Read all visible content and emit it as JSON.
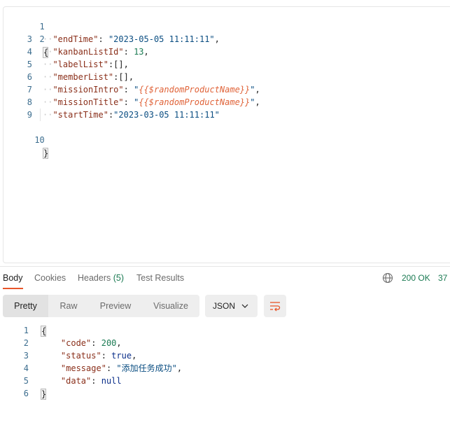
{
  "request_editor": {
    "line_numbers": [
      "1",
      "2",
      "3",
      "4",
      "5",
      "6",
      "7",
      "8",
      "9",
      "10"
    ],
    "open_brace": "{",
    "close_brace": "}",
    "lines": [
      {
        "key": "\"endTime\"",
        "sep": ": ",
        "value": "\"2023-05-05 11:11:11\"",
        "value_kind": "str",
        "trail": ","
      },
      {
        "key": "\"kanbanListId\"",
        "sep": ": ",
        "value": "13",
        "value_kind": "num",
        "trail": ","
      },
      {
        "key": "\"labelList\"",
        "sep": ":",
        "value": "[]",
        "value_kind": "plain",
        "trail": ","
      },
      {
        "key": "\"memberList\"",
        "sep": ":",
        "value": "[]",
        "value_kind": "plain",
        "trail": ","
      },
      {
        "key": "\"missionIntro\"",
        "sep": ": ",
        "value_prefix": "\"",
        "value": "{{$randomProductName}}",
        "value_suffix": "\"",
        "value_kind": "var",
        "trail": ","
      },
      {
        "key": "\"missionTitle\"",
        "sep": ": ",
        "value_prefix": "\"",
        "value": "{{$randomProductName}}",
        "value_suffix": "\"",
        "value_kind": "var",
        "trail": ","
      },
      {
        "key": "\"startTime\"",
        "sep": ":",
        "value": "\"2023-03-05 11:11:11\"",
        "value_kind": "str",
        "trail": ""
      }
    ]
  },
  "response_tabs": {
    "body": "Body",
    "cookies": "Cookies",
    "headers_label": "Headers",
    "headers_count": "(5)",
    "test_results": "Test Results",
    "globe_icon": "globe-icon",
    "status": "200 OK",
    "time": "37"
  },
  "format_toolbar": {
    "pretty": "Pretty",
    "raw": "Raw",
    "preview": "Preview",
    "visualize": "Visualize",
    "format_select": "JSON",
    "chevron_icon": "chevron-down-icon",
    "wrap_icon": "wrap-lines-icon"
  },
  "response_body": {
    "line_numbers": [
      "1",
      "2",
      "3",
      "4",
      "5",
      "6"
    ],
    "open_brace": "{",
    "close_brace": "}",
    "lines": [
      {
        "key": "\"code\"",
        "value": "200",
        "value_kind": "num",
        "trail": ","
      },
      {
        "key": "\"status\"",
        "value": "true",
        "value_kind": "bool",
        "trail": ","
      },
      {
        "key": "\"message\"",
        "value": "\"添加任务成功\"",
        "value_kind": "str",
        "trail": ","
      },
      {
        "key": "\"data\"",
        "value": "null",
        "value_kind": "bool",
        "trail": ""
      }
    ]
  },
  "colors": {
    "accent": "#e8562a",
    "status_ok": "#1a7a52",
    "json_key": "#8a2f1a",
    "json_string": "#0b4e82",
    "json_variable": "#e0643a"
  }
}
